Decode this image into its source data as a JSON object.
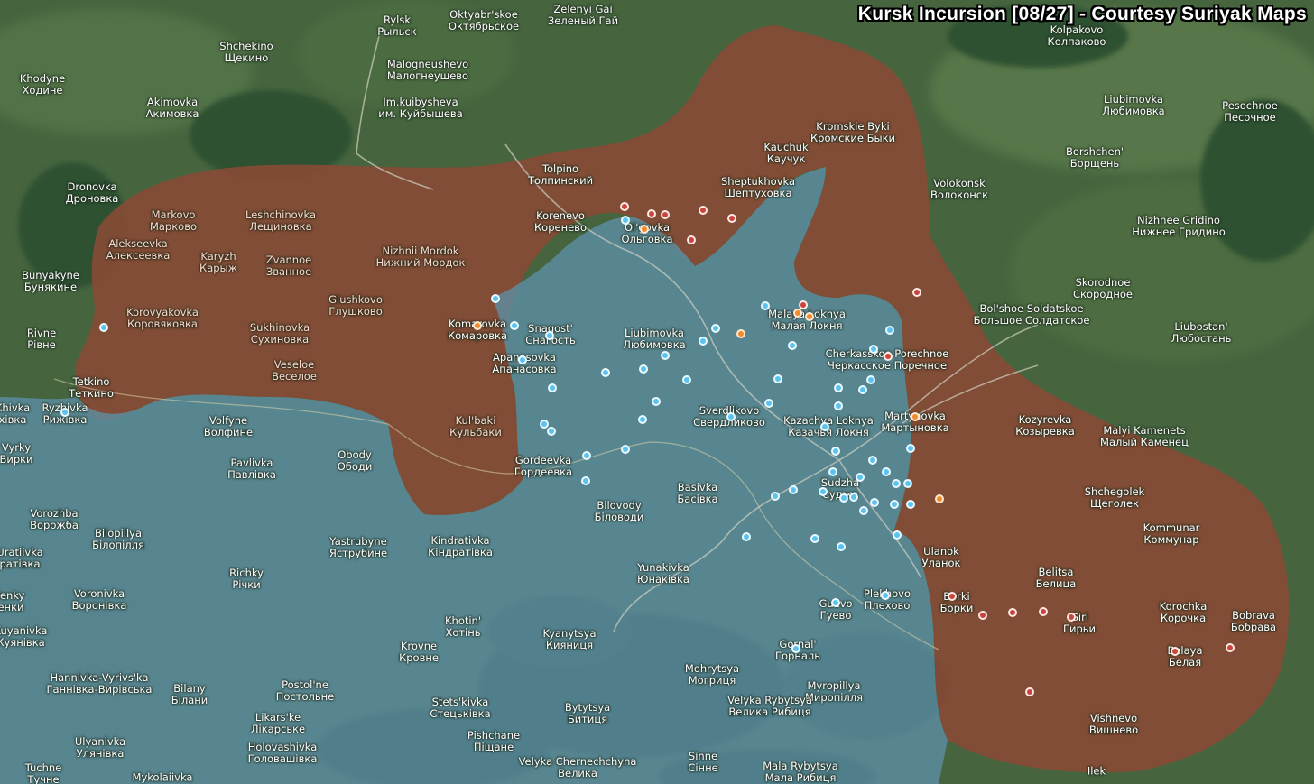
{
  "title": "Kursk Incursion [08/27] - Courtesy Suriyak Maps",
  "colors": {
    "terrain": "#3d5a3f",
    "forest": "#2a4a2f",
    "ukraine_control": "#5e8fa6",
    "russian_contested": "#8a4a35",
    "dot_blue": "#5cc3f0",
    "dot_orange": "#f08a2a",
    "dot_red": "#c8443c"
  },
  "labels": [
    {
      "lat": "Rylsk",
      "cyr": "Рыльск"
    },
    {
      "lat": "Oktyabr'skoe",
      "cyr": "Октябрьское"
    },
    {
      "lat": "Zelenyi Gai",
      "cyr": "Зеленый Гай"
    },
    {
      "lat": "Kolpakovo",
      "cyr": "Колпаково"
    },
    {
      "lat": "Shchekino",
      "cyr": "Щекино"
    },
    {
      "lat": "Malogneushevo",
      "cyr": "Малогнеушево"
    },
    {
      "lat": "Khodyne",
      "cyr": "Ходине"
    },
    {
      "lat": "Akimovka",
      "cyr": "Акимовка"
    },
    {
      "lat": "Im.kuibysheva",
      "cyr": "им. Куйбышева"
    },
    {
      "lat": "Liubimovka",
      "cyr": "Любимовка"
    },
    {
      "lat": "Pesochnoe",
      "cyr": "Песочное"
    },
    {
      "lat": "Kromskie Byki",
      "cyr": "Кромские Быки"
    },
    {
      "lat": "Kauchuk",
      "cyr": "Каучук"
    },
    {
      "lat": "Tolpino",
      "cyr": "Толпинский"
    },
    {
      "lat": "Borshchen'",
      "cyr": "Борщень"
    },
    {
      "lat": "Dronovka",
      "cyr": "Дроновка"
    },
    {
      "lat": "Sheptukhovka",
      "cyr": "Шептуховка"
    },
    {
      "lat": "Volokonsk",
      "cyr": "Волоконск"
    },
    {
      "lat": "Markovo",
      "cyr": "Марково"
    },
    {
      "lat": "Leshchinovka",
      "cyr": "Лещиновка"
    },
    {
      "lat": "Korenevo",
      "cyr": "Коренево"
    },
    {
      "lat": "Ol'govka",
      "cyr": "Ольговка"
    },
    {
      "lat": "Nizhnee Gridino",
      "cyr": "Нижнее Гридино"
    },
    {
      "lat": "Alekseevka",
      "cyr": "Алексеевка"
    },
    {
      "lat": "Karyzh",
      "cyr": "Карыж"
    },
    {
      "lat": "Zvannoe",
      "cyr": "Званное"
    },
    {
      "lat": "Nizhnii Mordok",
      "cyr": "Нижний Мордок"
    },
    {
      "lat": "Skorodnoe",
      "cyr": "Скородное"
    },
    {
      "lat": "Bunyakyne",
      "cyr": "Бунякине"
    },
    {
      "lat": "Glushkovo",
      "cyr": "Глушково"
    },
    {
      "lat": "Bol'shoe Soldatskoe",
      "cyr": "Большое Солдатское"
    },
    {
      "lat": "Malaya Loknya",
      "cyr": "Малая Локня"
    },
    {
      "lat": "Korovyakovka",
      "cyr": "Коровяковка"
    },
    {
      "lat": "Komarovka",
      "cyr": "Комаровка"
    },
    {
      "lat": "Snagost'",
      "cyr": "Снагость"
    },
    {
      "lat": "Liubimovka",
      "cyr": "Любимовка"
    },
    {
      "lat": "Rivne",
      "cyr": "Рівне"
    },
    {
      "lat": "Sukhinovka",
      "cyr": "Сухиновка"
    },
    {
      "lat": "Liubostan'",
      "cyr": "Любостань"
    },
    {
      "lat": "Cherkasskoe Porechnoe",
      "cyr": "Черкасское Поречное"
    },
    {
      "lat": "Apanasovka",
      "cyr": "Апанасовка"
    },
    {
      "lat": "Veseloe",
      "cyr": "Веселое"
    },
    {
      "lat": "Tetkino",
      "cyr": "Теткино"
    },
    {
      "lat": "Ryzhivka",
      "cyr": "Рижівка"
    },
    {
      "lat": "Sverdlikovo",
      "cyr": "Свердликово"
    },
    {
      "lat": "Martynovka",
      "cyr": "Мартыновка"
    },
    {
      "lat": "Kazachya Loknya",
      "cyr": "Казачья Локня"
    },
    {
      "lat": "Kozyrevka",
      "cyr": "Козыревка"
    },
    {
      "lat": "Malyi Kamenets",
      "cyr": "Малый Каменец"
    },
    {
      "lat": "Volfyne",
      "cyr": "Волфине"
    },
    {
      "lat": "Kul'baki",
      "cyr": "Кульбаки"
    },
    {
      "lat": "Vyrky",
      "cyr": "Вирки"
    },
    {
      "lat": "Obody",
      "cyr": "Ободи"
    },
    {
      "lat": "Pavlivka",
      "cyr": "Павлівка"
    },
    {
      "lat": "Gordeevka",
      "cyr": "Гордеевка"
    },
    {
      "lat": "Sudzha",
      "cyr": "Суджа"
    },
    {
      "lat": "Basivka",
      "cyr": "Басівка"
    },
    {
      "lat": "Shchegolek",
      "cyr": "Щеголек"
    },
    {
      "lat": "Vorozhba",
      "cyr": "Ворожба"
    },
    {
      "lat": "Bilovody",
      "cyr": "Біловоди"
    },
    {
      "lat": "Bilopillya",
      "cyr": "Білопілля"
    },
    {
      "lat": "Yastrubyne",
      "cyr": "Яструбине"
    },
    {
      "lat": "Kindrativka",
      "cyr": "Кіндратівка"
    },
    {
      "lat": "Kommunar",
      "cyr": "Коммунар"
    },
    {
      "lat": "Uratiivka",
      "cyr": "ратівка"
    },
    {
      "lat": "Ulanok",
      "cyr": "Уланок"
    },
    {
      "lat": "Richky",
      "cyr": "Річки"
    },
    {
      "lat": "Yunakivka",
      "cyr": "Юнаківка"
    },
    {
      "lat": "Belitsa",
      "cyr": "Белица"
    },
    {
      "lat": "Voronivka",
      "cyr": "Воронівка"
    },
    {
      "lat": "Plekhovo",
      "cyr": "Плехово"
    },
    {
      "lat": "Guevo",
      "cyr": "Гуево"
    },
    {
      "lat": "Borki",
      "cyr": "Борки"
    },
    {
      "lat": "Korochka",
      "cyr": "Корочка"
    },
    {
      "lat": "Bobrava",
      "cyr": "Бобрава"
    },
    {
      "lat": "Giri",
      "cyr": "Гирьи"
    },
    {
      "lat": "Khotin'",
      "cyr": "Хотінь"
    },
    {
      "lat": "Kuyanivka",
      "cyr": "Куянівка"
    },
    {
      "lat": "Kyanytsya",
      "cyr": "Кияниця"
    },
    {
      "lat": "Krovne",
      "cyr": "Кровне"
    },
    {
      "lat": "Gornal'",
      "cyr": "Горналь"
    },
    {
      "lat": "Belaya",
      "cyr": "Белая"
    },
    {
      "lat": "Mohrytsya",
      "cyr": "Могриця"
    },
    {
      "lat": "Hannivka-Vyrivs'ka",
      "cyr": "Ганнівка-Вирівська"
    },
    {
      "lat": "Bilany",
      "cyr": "Білани"
    },
    {
      "lat": "Postol'ne",
      "cyr": "Постольне"
    },
    {
      "lat": "Myropillya",
      "cyr": "Миропілля"
    },
    {
      "lat": "Velyka Rybytsya",
      "cyr": "Велика Рибиця"
    },
    {
      "lat": "Stets'kivka",
      "cyr": "Стецьківка"
    },
    {
      "lat": "Bytytsya",
      "cyr": "Битиця"
    },
    {
      "lat": "Vishnevo",
      "cyr": "Вишнево"
    },
    {
      "lat": "Likars'ke",
      "cyr": "Лікарське"
    },
    {
      "lat": "Holovashivka",
      "cyr": "Головашівка"
    },
    {
      "lat": "Pishchane",
      "cyr": "Піщане"
    },
    {
      "lat": "Ulyanivka",
      "cyr": "Улянівка"
    },
    {
      "lat": "Velyka Chernechchyna",
      "cyr": "Велика"
    },
    {
      "lat": "Sinne",
      "cyr": "Сінне"
    },
    {
      "lat": "Mala Rybytsya",
      "cyr": "Мала Рибиця"
    },
    {
      "lat": "Tuchne",
      "cyr": "Тучне"
    },
    {
      "lat": "Mykolaiivka",
      "cyr": ""
    },
    {
      "lat": "Ilek",
      "cyr": ""
    },
    {
      "lat": "Khivka",
      "cyr": "хівка"
    },
    {
      "lat": "Ienky",
      "cyr": "енки"
    }
  ]
}
